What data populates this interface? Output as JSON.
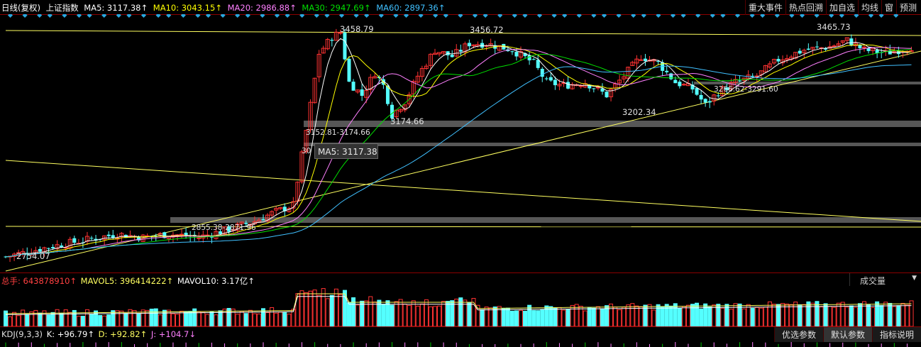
{
  "header": {
    "chart_type": "日线(复权)",
    "index_name": "上证指数",
    "ma5": {
      "label": "MA5: 3117.38↑",
      "color": "#ffffff"
    },
    "ma10": {
      "label": "MA10: 3043.15↑",
      "color": "#ffff00"
    },
    "ma20": {
      "label": "MA20: 2986.88↑",
      "color": "#ff80ff"
    },
    "ma30": {
      "label": "MA30: 2947.69↑",
      "color": "#00e000"
    },
    "ma60": {
      "label": "MA60: 2897.36↑",
      "color": "#40c0ff"
    }
  },
  "toolbar": {
    "buttons": [
      "重大事件",
      "热点回溯",
      "加自选",
      "均线",
      "窗",
      "预测"
    ]
  },
  "annotations": {
    "high1": "3458.79",
    "high2": "3456.72",
    "high3": "3465.73",
    "low1": "3174.66",
    "low2": "3202.34",
    "low_start": "2754.07",
    "gap1": "3152.81-3174.66",
    "gap2": "3266.62-3291.60",
    "gap3": "2855.38-2871.96",
    "cut": "30"
  },
  "tooltip": "MA5: 3117.38",
  "volume": {
    "total_label": "总手: 643878910↑",
    "mavol5": "MAVOL5: 396414222↑",
    "mavol10": "MAVOL10: 3.17亿↑",
    "selector": "成交量",
    "arrow": "▼"
  },
  "kdj": {
    "label": "KDJ(9,3,3)",
    "k": "K: +96.79↑",
    "d": "D: +92.82↑",
    "j": "J: +104.7↓",
    "buttons": [
      "优选参数",
      "默认参数",
      "指标说明"
    ]
  },
  "colors": {
    "up": "#ff3232",
    "down": "#54ffff",
    "border": "#8b0000",
    "trend": "#ffff60",
    "gapband": "#666666"
  },
  "chart_data": {
    "type": "candlestick",
    "series": [
      {
        "name": "K线"
      },
      {
        "name": "MA5"
      },
      {
        "name": "MA10"
      },
      {
        "name": "MA20"
      },
      {
        "name": "MA30"
      },
      {
        "name": "MA60"
      }
    ],
    "labeled_highs": [
      3458.79,
      3456.72,
      3465.73
    ],
    "labeled_lows": [
      2754.07,
      3174.66,
      3202.34
    ],
    "price_range_estimate": [
      2720,
      3500
    ]
  }
}
